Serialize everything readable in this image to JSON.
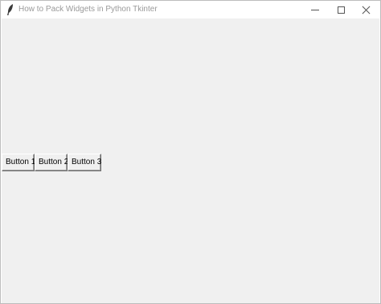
{
  "window": {
    "title": "How to Pack Widgets in Python Tkinter",
    "app_icon": "tk-feather-icon",
    "controls": {
      "minimize_icon": "minimize-icon",
      "maximize_icon": "maximize-icon",
      "close_icon": "close-icon"
    }
  },
  "buttons": [
    {
      "label": "Button 1"
    },
    {
      "label": "Button 2"
    },
    {
      "label": "Button 3"
    }
  ],
  "colors": {
    "client_background": "#f0f0f0",
    "title_text": "#9a9a9a"
  }
}
